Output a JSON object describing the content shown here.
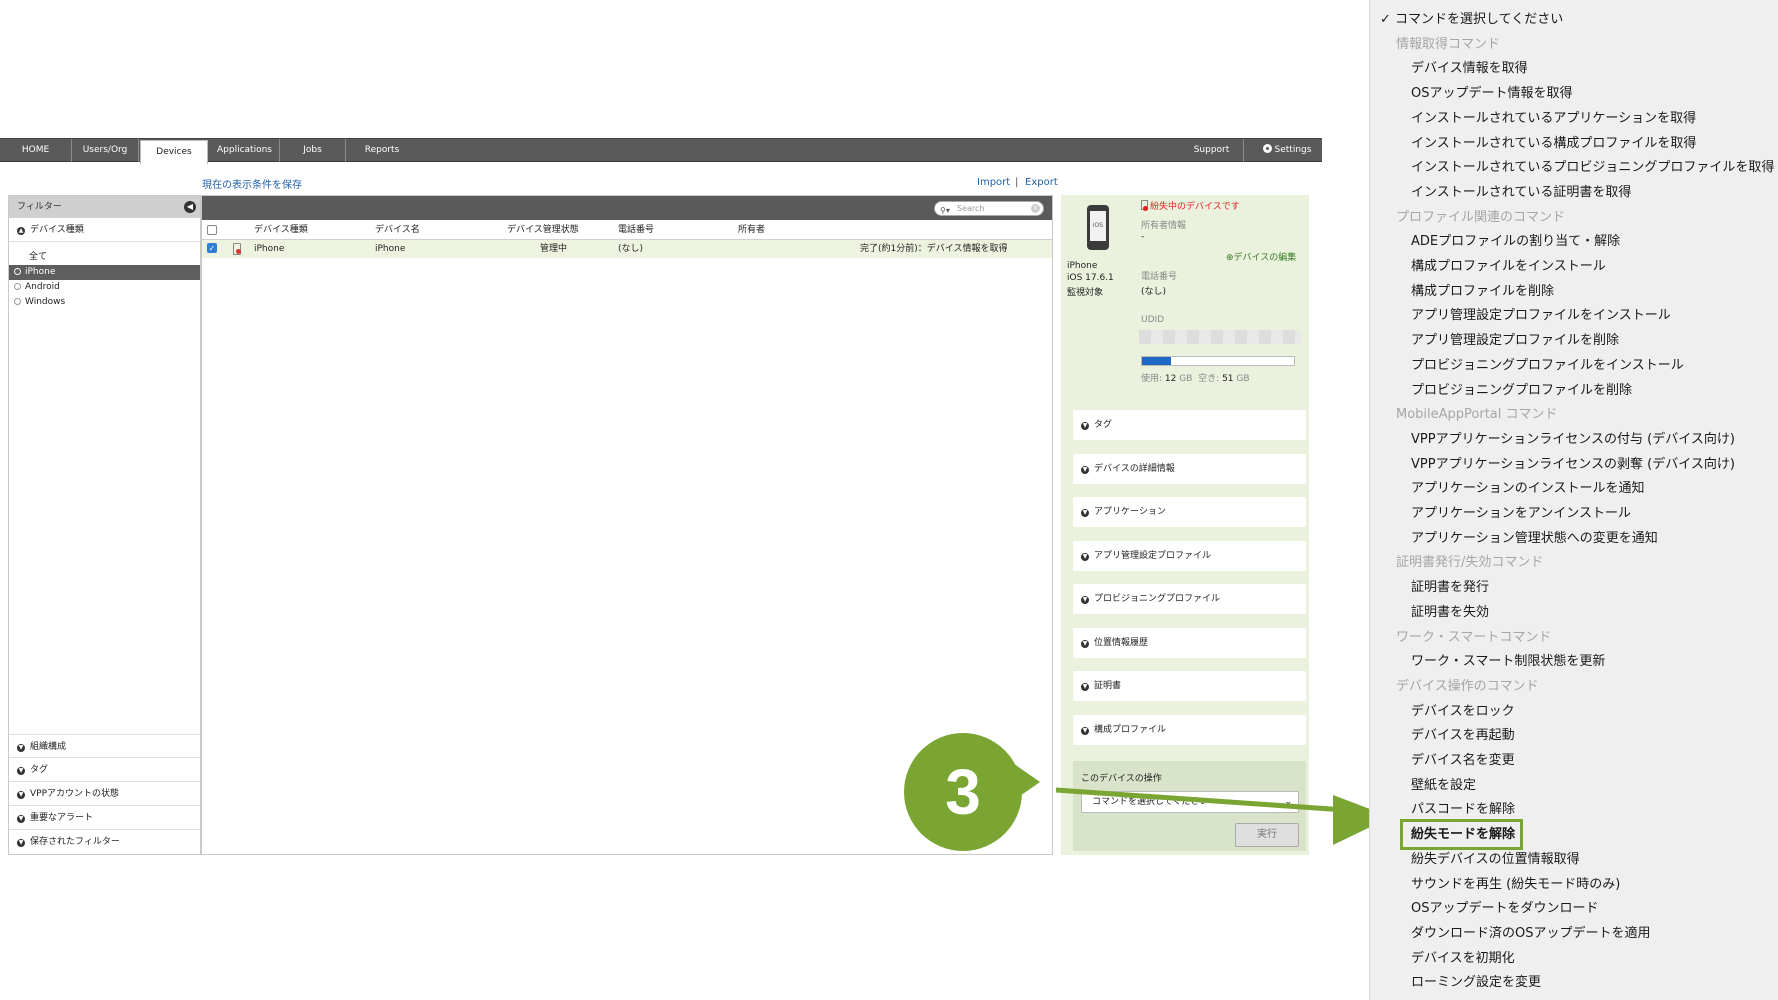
{
  "nav": {
    "tabs": [
      "HOME",
      "Users/Org",
      "Devices",
      "Applications",
      "Jobs",
      "Reports"
    ],
    "active": "Devices",
    "support": "Support",
    "settings": "Settings"
  },
  "links": {
    "save_filter": "現在の表示条件を保存",
    "import": "Import",
    "separator": "|",
    "export": "Export"
  },
  "filter": {
    "title": "フィルター",
    "device_type_section": "デバイス種類",
    "device_types": [
      "全て",
      "iPhone",
      "Android",
      "Windows"
    ],
    "selected_device_type": "iPhone",
    "bottom_sections": [
      "組織構成",
      "タグ",
      "VPPアカウントの状態",
      "重要なアラート",
      "保存されたフィルター"
    ]
  },
  "table": {
    "search_placeholder": "Search",
    "headers": [
      "デバイス種類",
      "デバイス名",
      "デバイス管理状態",
      "電話番号",
      "所有者"
    ],
    "row": {
      "device_type": "iPhone",
      "device_name": "iPhone",
      "status": "管理中",
      "phone": "(なし)",
      "owner": "",
      "job": "完了(約1分前)：デバイス情報を取得"
    }
  },
  "detail": {
    "icon_label": "iOS",
    "model": "iPhone",
    "os": "iOS 17.6.1",
    "supervised": "監視対象",
    "lost_notice": "紛失中のデバイスです",
    "owner_label": "所有者情報",
    "owner_value": "-",
    "edit_link": "デバイスの編集",
    "phone_label": "電話番号",
    "phone_value": "(なし)",
    "udid_label": "UDID",
    "storage": {
      "used_label": "使用:",
      "used_value": "12",
      "used_unit": "GB",
      "free_label": "空き:",
      "free_value": "51",
      "free_unit": "GB",
      "used_fraction": 0.19
    },
    "sections": [
      "タグ",
      "デバイスの詳細情報",
      "アプリケーション",
      "アプリ管理設定プロファイル",
      "プロビジョニングプロファイル",
      "位置情報履歴",
      "証明書",
      "構成プロファイル"
    ],
    "operation_title": "このデバイスの操作",
    "select_value": "コマンドを選択してください",
    "run_button": "実行"
  },
  "annotation": {
    "step": "3",
    "accent": "#7aa533"
  },
  "menu": {
    "checked_item": "コマンドを選択してください",
    "highlighted": "紛失モードを解除",
    "groups": [
      {
        "title": "情報取得コマンド",
        "items": [
          "デバイス情報を取得",
          "OSアップデート情報を取得",
          "インストールされているアプリケーションを取得",
          "インストールされている構成プロファイルを取得",
          "インストールされているプロビジョニングプロファイルを取得",
          "インストールされている証明書を取得"
        ]
      },
      {
        "title": "プロファイル関連のコマンド",
        "items": [
          "ADEプロファイルの割り当て・解除",
          "構成プロファイルをインストール",
          "構成プロファイルを削除",
          "アプリ管理設定プロファイルをインストール",
          "アプリ管理設定プロファイルを削除",
          "プロビジョニングプロファイルをインストール",
          "プロビジョニングプロファイルを削除"
        ]
      },
      {
        "title": "MobileAppPortal コマンド",
        "items": [
          "VPPアプリケーションライセンスの付与 (デバイス向け)",
          "VPPアプリケーションライセンスの剥奪 (デバイス向け)",
          "アプリケーションのインストールを通知",
          "アプリケーションをアンインストール",
          "アプリケーション管理状態への変更を通知"
        ]
      },
      {
        "title": "証明書発行/失効コマンド",
        "items": [
          "証明書を発行",
          "証明書を失効"
        ]
      },
      {
        "title": "ワーク・スマートコマンド",
        "items": [
          "ワーク・スマート制限状態を更新"
        ]
      },
      {
        "title": "デバイス操作のコマンド",
        "items": [
          "デバイスをロック",
          "デバイスを再起動",
          "デバイス名を変更",
          "壁紙を設定",
          "パスコードを解除",
          "紛失モードを解除",
          "紛失デバイスの位置情報取得",
          "サウンドを再生 (紛失モード時のみ)",
          "OSアップデートをダウンロード",
          "ダウンロード済のOSアップデートを適用",
          "デバイスを初期化",
          "ローミング設定を変更"
        ]
      }
    ]
  }
}
